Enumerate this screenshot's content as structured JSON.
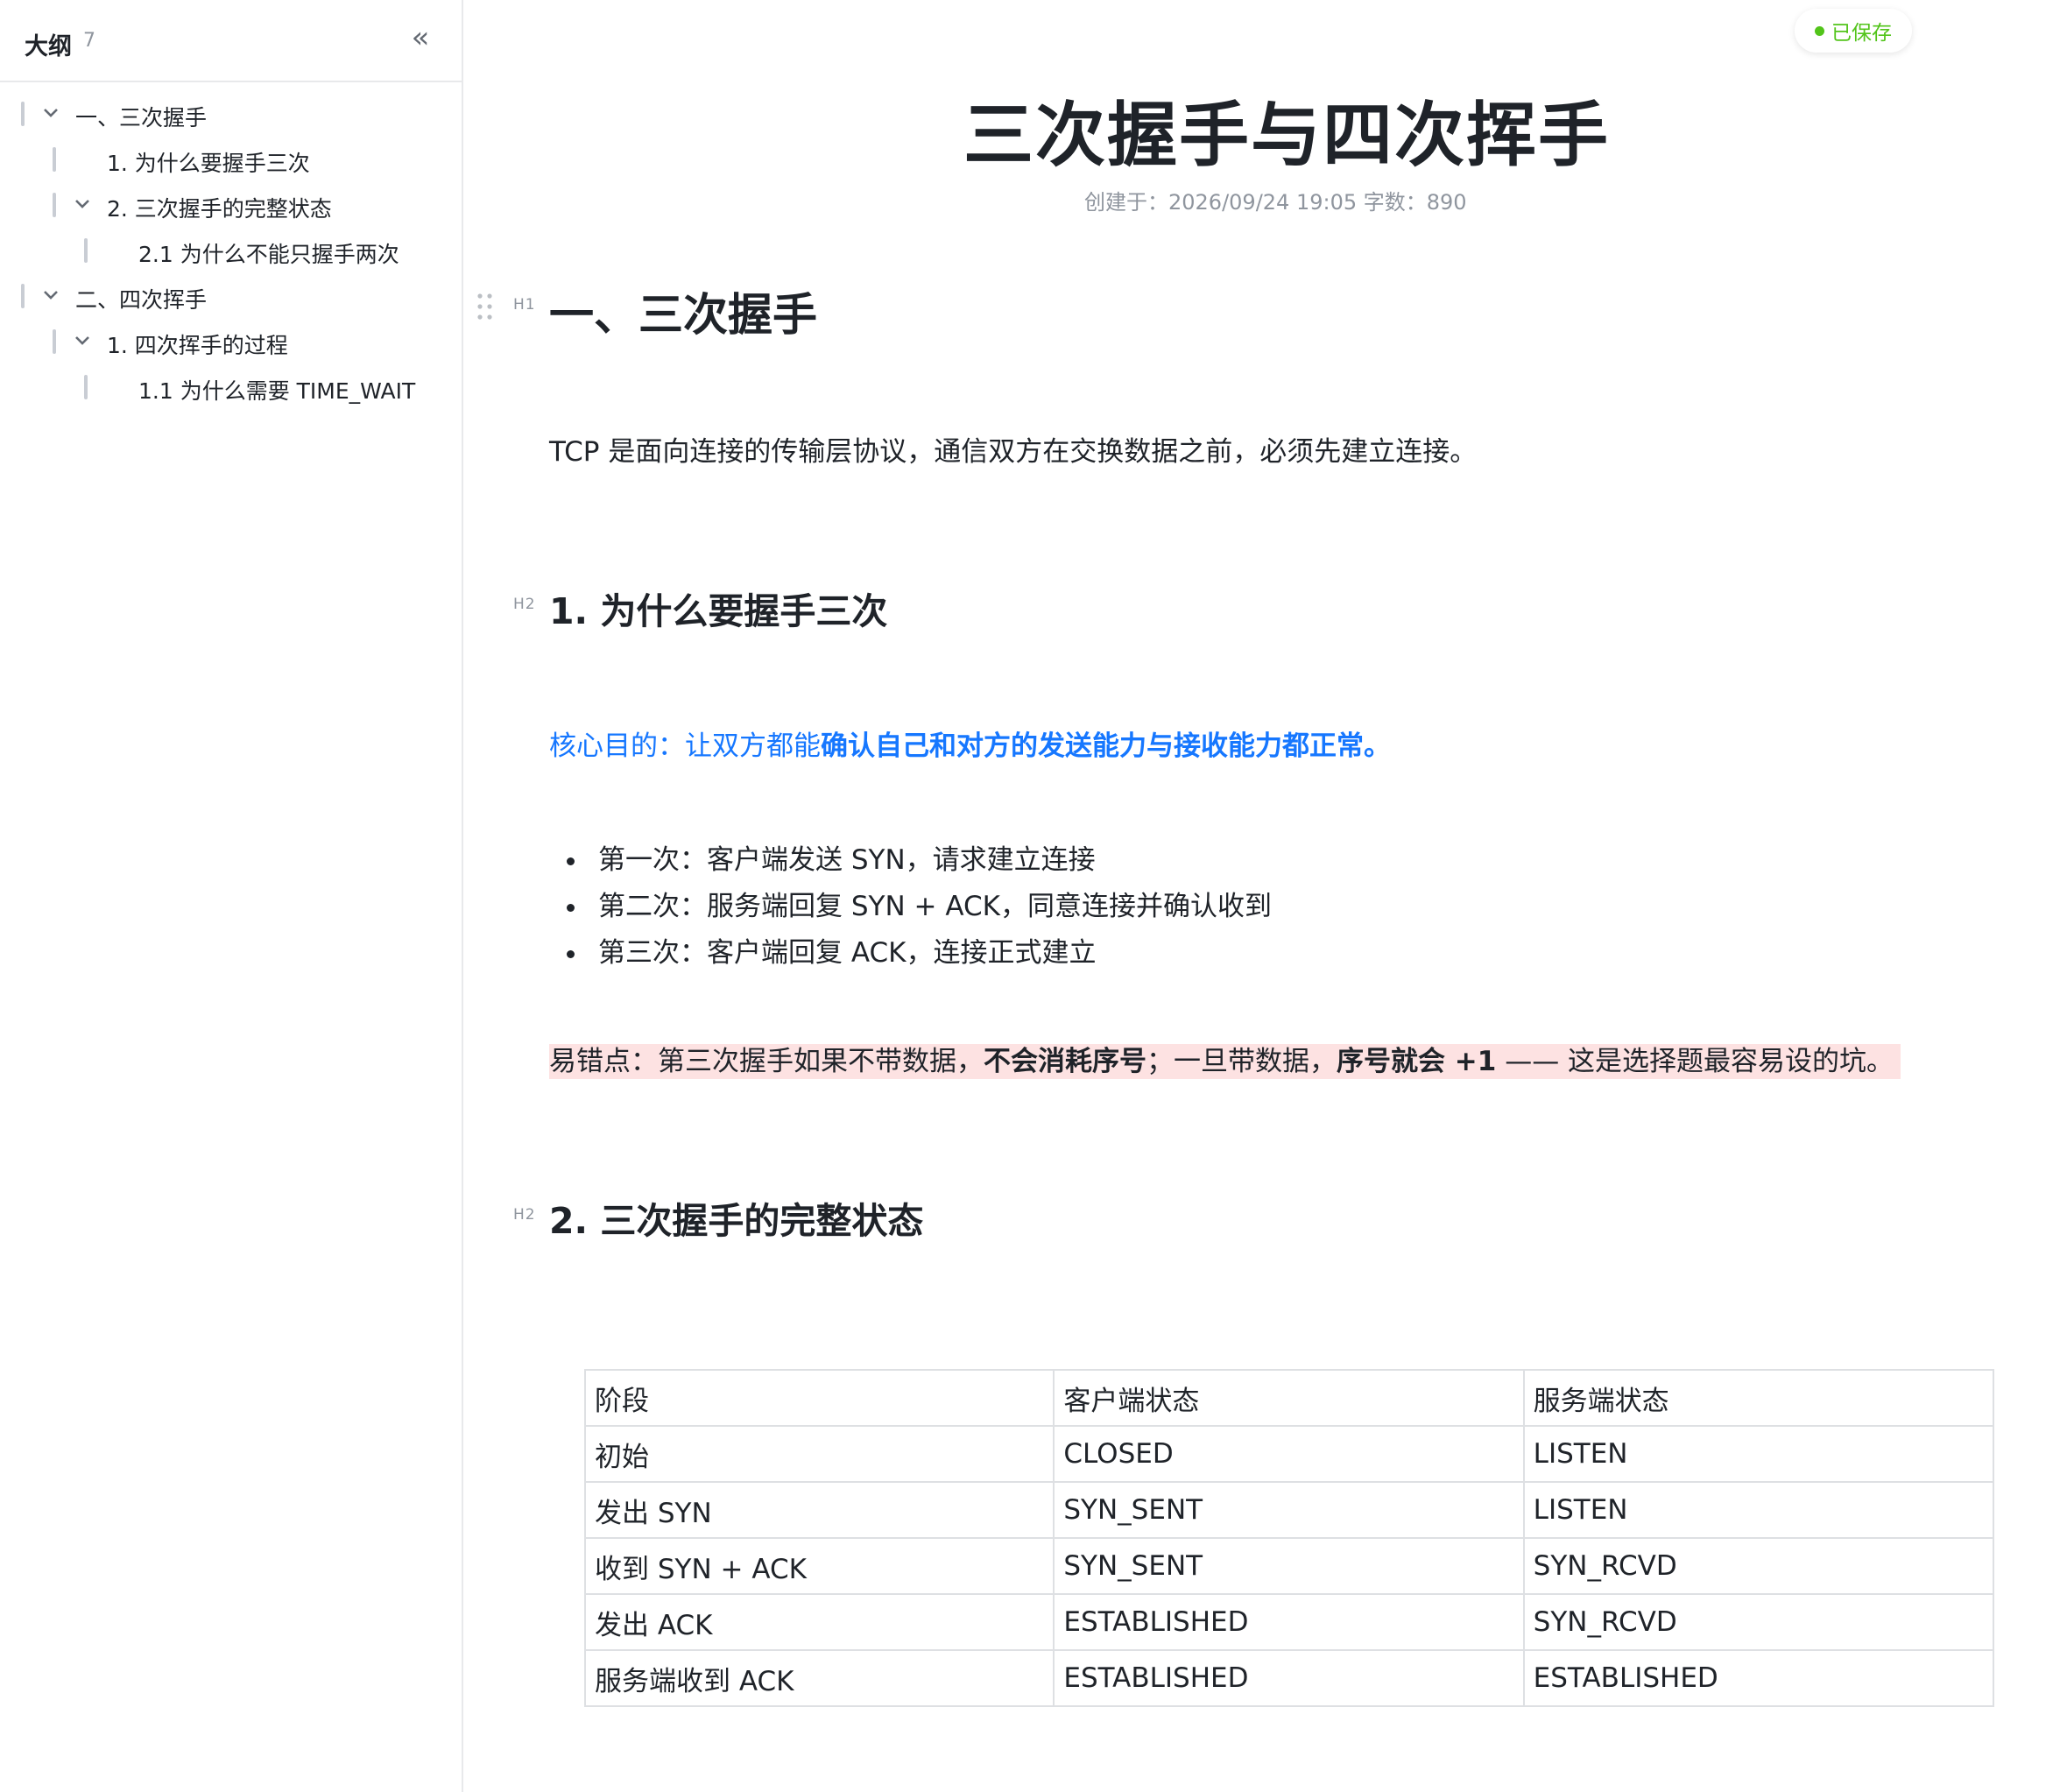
{
  "sidebar": {
    "title": "大纲",
    "count": "7",
    "collapse_icon": "«",
    "items": [
      {
        "label": "一、三次握手",
        "level": 1,
        "expanded": true
      },
      {
        "label": "1. 为什么要握手三次",
        "level": 2,
        "expanded": null
      },
      {
        "label": "2. 三次握手的完整状态",
        "level": 2,
        "expanded": true
      },
      {
        "label": "2.1 为什么不能只握手两次",
        "level": 3,
        "expanded": null
      },
      {
        "label": "二、四次挥手",
        "level": 1,
        "expanded": true
      },
      {
        "label": "1. 四次挥手的过程",
        "level": 2,
        "expanded": true
      },
      {
        "label": "1.1 为什么需要 TIME_WAIT",
        "level": 3,
        "expanded": null
      }
    ]
  },
  "status": {
    "saved_label": "已保存",
    "color": "#52c41a"
  },
  "document": {
    "title": "三次握手与四次挥手",
    "meta": "创建于：2026/09/24 19:05 字数：890",
    "h1_tag": "H1",
    "h2_tag": "H2",
    "section1_heading": "一、三次握手",
    "intro": "TCP 是面向连接的传输层协议，通信双方在交换数据之前，必须先建立连接。",
    "sub1_heading": "1. 为什么要握手三次",
    "core_prefix": "核心目的：让双方都能",
    "core_bold": "确认自己和对方的发送能力与接收能力都正常。",
    "bullets": [
      "第一次：客户端发送 SYN，请求建立连接",
      "第二次：服务端回复 SYN + ACK，同意连接并确认收到",
      "第三次：客户端回复 ACK，连接正式建立"
    ],
    "warn": {
      "t1": "易错点：第三次握手如果不带数据，",
      "b1": "不会消耗序号",
      "t2": "；一旦带数据，",
      "b2": "序号就会 +1",
      "t3": " —— 这是选择题最容易设的坑。"
    },
    "sub2_heading": "2. 三次握手的完整状态",
    "table": {
      "headers": [
        "阶段",
        "客户端状态",
        "服务端状态"
      ],
      "rows": [
        [
          "初始",
          "CLOSED",
          "LISTEN"
        ],
        [
          "发出 SYN",
          "SYN_SENT",
          "LISTEN"
        ],
        [
          "收到 SYN + ACK",
          "SYN_SENT",
          "SYN_RCVD"
        ],
        [
          "发出 ACK",
          "ESTABLISHED",
          "SYN_RCVD"
        ],
        [
          "服务端收到 ACK",
          "ESTABLISHED",
          "ESTABLISHED"
        ]
      ]
    }
  },
  "colors": {
    "accent_blue": "#1677ff",
    "highlight_pink": "#fde2e2",
    "saved_green": "#52c41a"
  }
}
